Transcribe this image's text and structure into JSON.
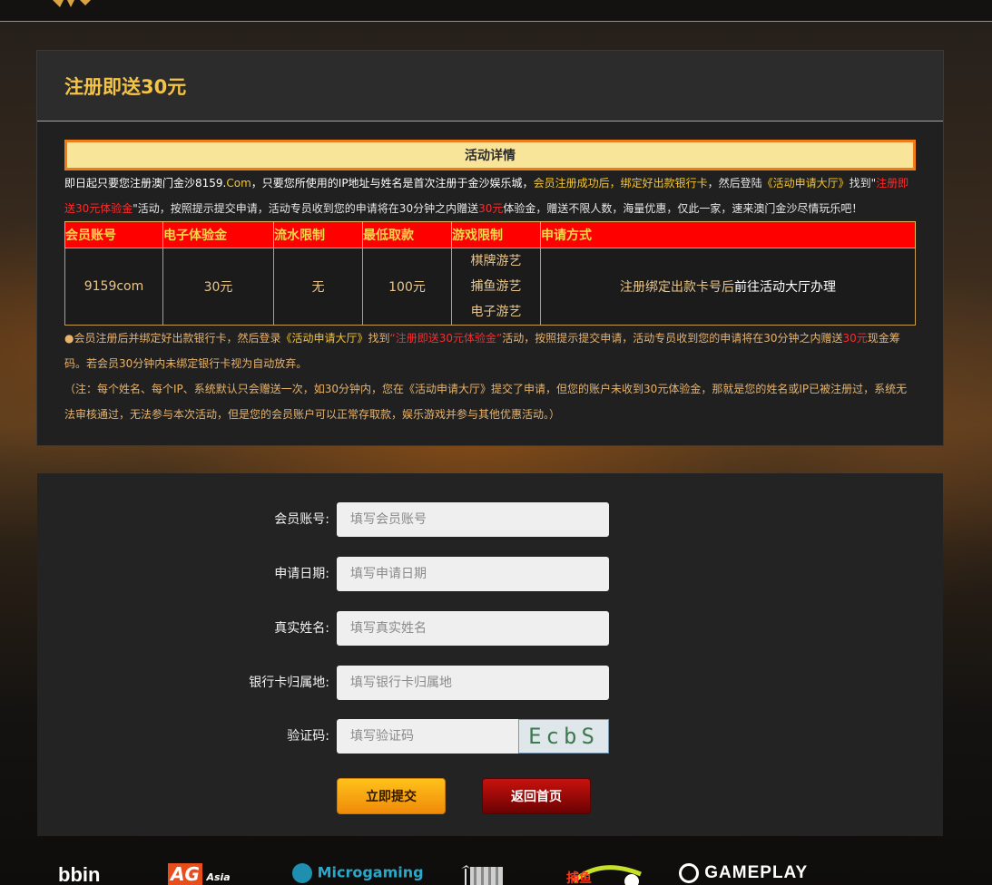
{
  "colors": {
    "accent": "#f5c445",
    "table_header_bg": "#ff0000",
    "submit_button": "#f5a30e",
    "home_button": "#a80808"
  },
  "promo": {
    "title": "注册即送30元",
    "detail_bar": "活动详情",
    "intro": {
      "p1": "即日起只要您注册澳门金沙8159.",
      "p2": "Com",
      "p3": "，只要您所使用的IP地址与姓名是首次注册于金沙娱乐城，",
      "p4": "会员注册成功后，绑定好出款银行卡",
      "p5": "，然后登陆",
      "p6": "《活动申请大厅》",
      "p7": "找到\"",
      "p8": "注册即送30元体验金",
      "p9": "\"活动，按照提示提交申请，活动专员收到您的申请将在30分钟之内赠送",
      "p10": "30元",
      "p11": "体验金，赠送不限人数，海量优惠，仅此一家，速来澳门金沙尽情玩乐吧！"
    },
    "table": {
      "headers": [
        "会员账号",
        "电子体验金",
        "流水限制",
        "最低取款",
        "游戏限制",
        "申请方式"
      ],
      "row": {
        "account": "9159com",
        "bonus": "30元",
        "turnover": "无",
        "min_withdraw": "100元",
        "games": [
          "棋牌游艺",
          "捕鱼游艺",
          "电子游艺"
        ],
        "method_a": "注册绑定出款卡号后",
        "method_b": "前往活动大厅办理"
      }
    },
    "note1": {
      "p1": "●会员注册后并绑定好出款银行卡，然后登录",
      "p2": "《活动申请大厅》",
      "p3": "找到",
      "p4": "“注册即送30元体验金”",
      "p5": "活动，按照提示提交申请，活动专员收到您的申请将在30分钟之内赠送",
      "p6": "30元",
      "p7": "现金筹码。若会员30分钟内未绑定银行卡视为自动放弃。"
    },
    "note2": "（注：每个姓名、每个IP、系统默认只会赠送一次，如30分钟内，您在《活动申请大厅》提交了申请，但您的账户未收到30元体验金，那就是您的姓名或IP已被注册过，系统无法审核通过，无法参与本次活动，但是您的会员账户可以正常存取款，娱乐游戏并参与其他优惠活动。）"
  },
  "form": {
    "account": {
      "label": "会员账号:",
      "placeholder": "填写会员账号"
    },
    "date": {
      "label": "申请日期:",
      "placeholder": "填写申请日期"
    },
    "name": {
      "label": "真实姓名:",
      "placeholder": "填写真实姓名"
    },
    "bank": {
      "label": "银行卡归属地:",
      "placeholder": "填写银行卡归属地"
    },
    "captcha": {
      "label": "验证码:",
      "placeholder": "填写验证码",
      "image_text": "EcbS"
    },
    "submit_label": "立即提交",
    "home_label": "返回首页"
  },
  "partners": {
    "bbin": "bbin",
    "ag": "AG",
    "ag_sub": "Asia",
    "microgaming": "Microgaming",
    "fish": "捕鱼",
    "gameplay": "GAMEPLAY"
  }
}
